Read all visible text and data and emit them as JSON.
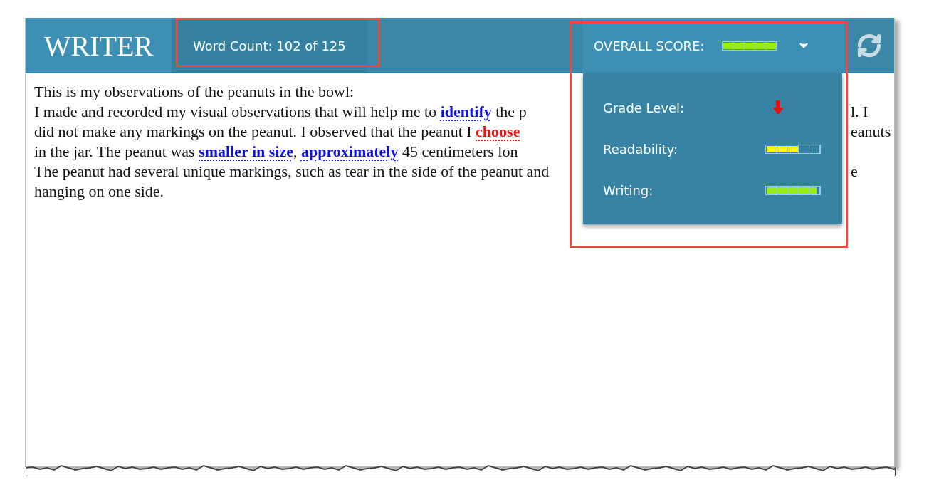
{
  "header": {
    "brand": "WRITER",
    "word_count": "Word Count: 102 of 125",
    "overall_score": {
      "label": "OVERALL SCORE:",
      "level": 1.0
    }
  },
  "score_menu": {
    "expanded": true,
    "items": [
      {
        "kind": "trend",
        "label": "Grade Level:"
      },
      {
        "kind": "meter",
        "label": "Readability:",
        "level": 0.6
      },
      {
        "kind": "meter",
        "label": "Writing:",
        "level": 0.95
      }
    ]
  },
  "document": {
    "lines": [
      {
        "left": [
          {
            "kind": "plain",
            "text": "This is my observations of the peanuts in the bowl:"
          }
        ]
      },
      {
        "left": [
          {
            "kind": "plain",
            "text": "I made and recorded my visual observations that will help me to "
          },
          {
            "kind": "suggestion",
            "text": "identify"
          },
          {
            "kind": "plain",
            "text": " the p"
          }
        ],
        "right": "l. I"
      },
      {
        "left": [
          {
            "kind": "plain",
            "text": "did not make any markings on the peanut. I observed that the peanut I "
          },
          {
            "kind": "error",
            "text": "choose"
          }
        ],
        "right": "eanuts"
      },
      {
        "left": [
          {
            "kind": "plain",
            "text": "in the jar. The peanut was "
          },
          {
            "kind": "suggestion",
            "text": "smaller in size"
          },
          {
            "kind": "plain",
            "text": ", "
          },
          {
            "kind": "suggestion",
            "text": "approximately"
          },
          {
            "kind": "plain",
            "text": " 45 centimeters lon"
          }
        ]
      },
      {
        "left": [
          {
            "kind": "plain",
            "text": "The peanut had several unique markings, such as tear in the side of the peanut and"
          }
        ],
        "right": "e"
      },
      {
        "left": [
          {
            "kind": "plain",
            "text": "hanging on one side."
          }
        ]
      }
    ]
  }
}
